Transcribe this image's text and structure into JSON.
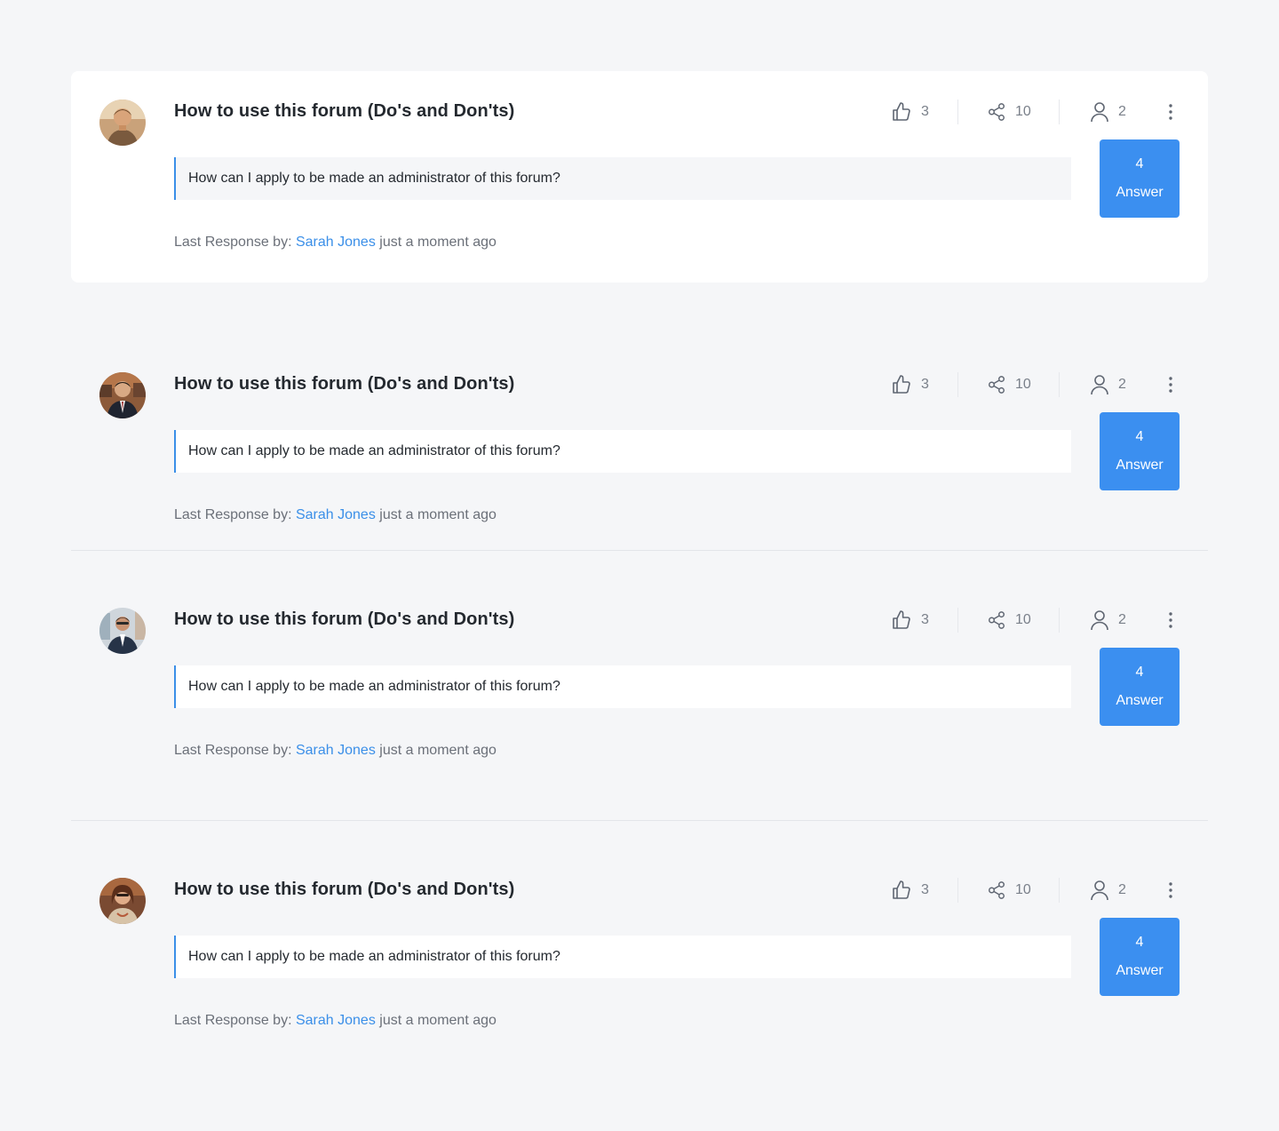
{
  "icons": {
    "like": "thumbs-up-icon",
    "share": "share-icon",
    "users": "user-icon",
    "more": "more-vertical-icon"
  },
  "colors": {
    "accent": "#3b8fe8",
    "button": "#3b8ff0",
    "background": "#f5f6f8",
    "muted": "#6b7079"
  },
  "threads": [
    {
      "title": "How to use this forum (Do's and Don'ts)",
      "question": "How can I apply to be made an administrator of this forum?",
      "likes": "3",
      "shares": "10",
      "users": "2",
      "answer_count": "4",
      "answer_label": "Answer",
      "last_response_prefix": "Last Response by:",
      "last_response_author": "Sarah Jones",
      "last_response_time": "just a moment ago"
    },
    {
      "title": "How to use this forum (Do's and Don'ts)",
      "question": "How can I apply to be made an administrator of this forum?",
      "likes": "3",
      "shares": "10",
      "users": "2",
      "answer_count": "4",
      "answer_label": "Answer",
      "last_response_prefix": "Last Response by:",
      "last_response_author": "Sarah Jones",
      "last_response_time": "just a moment ago"
    },
    {
      "title": "How to use this forum (Do's and Don'ts)",
      "question": "How can I apply to be made an administrator of this forum?",
      "likes": "3",
      "shares": "10",
      "users": "2",
      "answer_count": "4",
      "answer_label": "Answer",
      "last_response_prefix": "Last Response by:",
      "last_response_author": "Sarah Jones",
      "last_response_time": "just a moment ago"
    },
    {
      "title": "How to use this forum (Do's and Don'ts)",
      "question": "How can I apply to be made an administrator of this forum?",
      "likes": "3",
      "shares": "10",
      "users": "2",
      "answer_count": "4",
      "answer_label": "Answer",
      "last_response_prefix": "Last Response by:",
      "last_response_author": "Sarah Jones",
      "last_response_time": "just a moment ago"
    }
  ]
}
